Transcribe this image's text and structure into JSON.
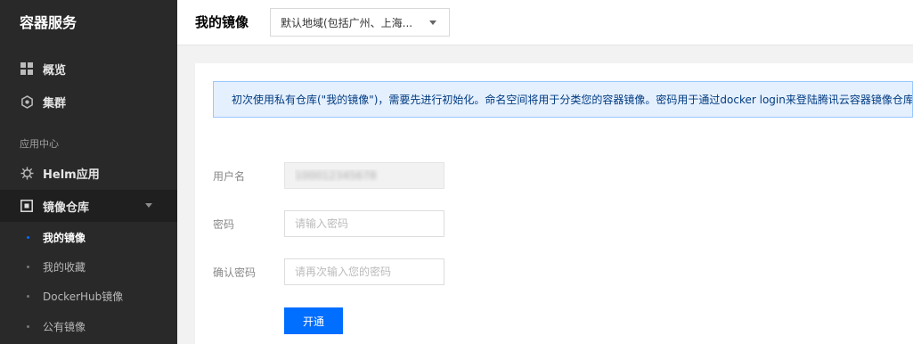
{
  "sidebar": {
    "brand": "容器服务",
    "items": [
      {
        "label": "概览",
        "icon": "grid-icon"
      },
      {
        "label": "集群",
        "icon": "cluster-icon"
      }
    ],
    "section_label": "应用中心",
    "helm": {
      "label": "Helm应用",
      "icon": "helm-icon"
    },
    "registry": {
      "label": "镜像仓库",
      "icon": "registry-icon"
    },
    "sub_items": [
      {
        "label": "我的镜像",
        "current": true
      },
      {
        "label": "我的收藏"
      },
      {
        "label": "DockerHub镜像"
      },
      {
        "label": "公有镜像"
      }
    ]
  },
  "header": {
    "title": "我的镜像",
    "region_select": {
      "value": "默认地域(包括广州、上海..."
    }
  },
  "main": {
    "notice": "初次使用私有仓库(\"我的镜像\")，需要先进行初始化。命名空间将用于分类您的容器镜像。密码用于通过docker login来登陆腾讯云容器镜像仓库。",
    "form": {
      "username_label": "用户名",
      "username_value": "100012345678",
      "password_label": "密码",
      "password_placeholder": "请输入密码",
      "confirm_label": "确认密码",
      "confirm_placeholder": "请再次输入您的密码",
      "submit_label": "开通"
    }
  },
  "colors": {
    "sidebar_bg": "#292929",
    "accent": "#006eff",
    "notice_bg": "#e5f0ff",
    "notice_border": "#97c7ff"
  }
}
